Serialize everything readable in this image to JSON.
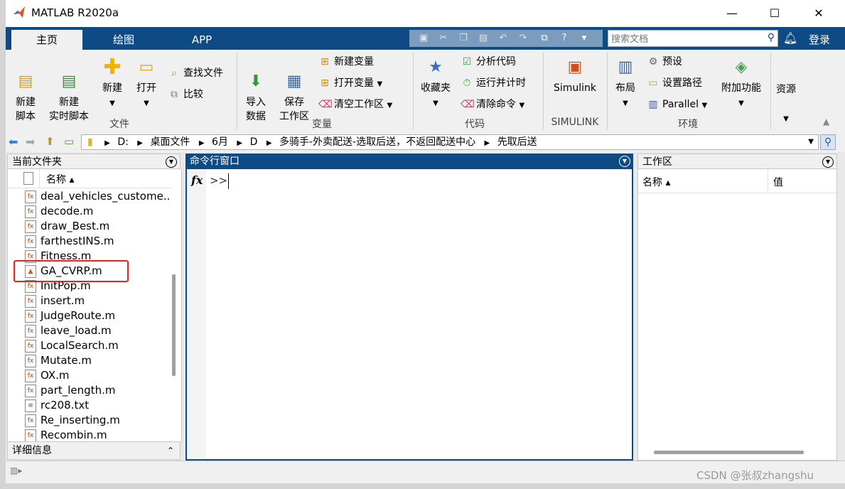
{
  "window": {
    "title": "MATLAB R2020a",
    "minimize": "—",
    "maximize": "☐",
    "close": "✕"
  },
  "tabs": [
    {
      "label": "主页"
    },
    {
      "label": "绘图"
    },
    {
      "label": "APP"
    }
  ],
  "search": {
    "placeholder": "搜索文档"
  },
  "login": "登录",
  "ribbon": {
    "file": {
      "group_label": "文件",
      "new_script": "新建\n脚本",
      "new_live_script": "新建\n实时脚本",
      "new": "新建",
      "open": "打开",
      "find_files": "查找文件",
      "compare": "比较"
    },
    "variable": {
      "group_label": "变量",
      "import_data": "导入\n数据",
      "save_workspace": "保存\n工作区",
      "new_variable": "新建变量",
      "open_variable": "打开变量",
      "clear_workspace": "清空工作区"
    },
    "code": {
      "group_label": "代码",
      "favorites": "收藏夹",
      "analyze_code": "分析代码",
      "run_and_time": "运行并计时",
      "clear_commands": "清除命令"
    },
    "simulink": {
      "group_label": "SIMULINK",
      "simulink": "Simulink"
    },
    "environment": {
      "group_label": "环境",
      "layout": "布局",
      "preferences": "预设",
      "set_path": "设置路径",
      "parallel": "Parallel",
      "addons": "附加功能"
    },
    "resources": {
      "label": "资源"
    }
  },
  "address": {
    "segments": [
      "D:",
      "桌面文件",
      "6月",
      "D",
      "多骑手-外卖配送-选取后送，不返回配送中心",
      "先取后送"
    ]
  },
  "current_folder": {
    "title": "当前文件夹",
    "column_name": "名称 ▴",
    "files": [
      {
        "name": "deal_vehicles_custome..",
        "type": "m"
      },
      {
        "name": "decode.m",
        "type": "m"
      },
      {
        "name": "draw_Best.m",
        "type": "m"
      },
      {
        "name": "farthestINS.m",
        "type": "m"
      },
      {
        "name": "Fitness.m",
        "type": "m"
      },
      {
        "name": "GA_CVRP.m",
        "type": "script"
      },
      {
        "name": "InitPop.m",
        "type": "m"
      },
      {
        "name": "insert.m",
        "type": "m"
      },
      {
        "name": "JudgeRoute.m",
        "type": "m"
      },
      {
        "name": "leave_load.m",
        "type": "m"
      },
      {
        "name": "LocalSearch.m",
        "type": "m"
      },
      {
        "name": "Mutate.m",
        "type": "m"
      },
      {
        "name": "OX.m",
        "type": "m"
      },
      {
        "name": "part_length.m",
        "type": "m"
      },
      {
        "name": "rc208.txt",
        "type": "txt"
      },
      {
        "name": "Re_inserting.m",
        "type": "m"
      },
      {
        "name": "Recombin.m",
        "type": "m"
      }
    ],
    "details": "详细信息"
  },
  "command_window": {
    "title": "命令行窗口",
    "fx": "fx",
    "prompt": ">>"
  },
  "workspace": {
    "title": "工作区",
    "col_name": "名称 ▴",
    "col_value": "值"
  },
  "watermark": "CSDN @张叔zhangshu",
  "colors": {
    "tab_bar": "#0e4a84",
    "highlight_box": "#e52323"
  }
}
